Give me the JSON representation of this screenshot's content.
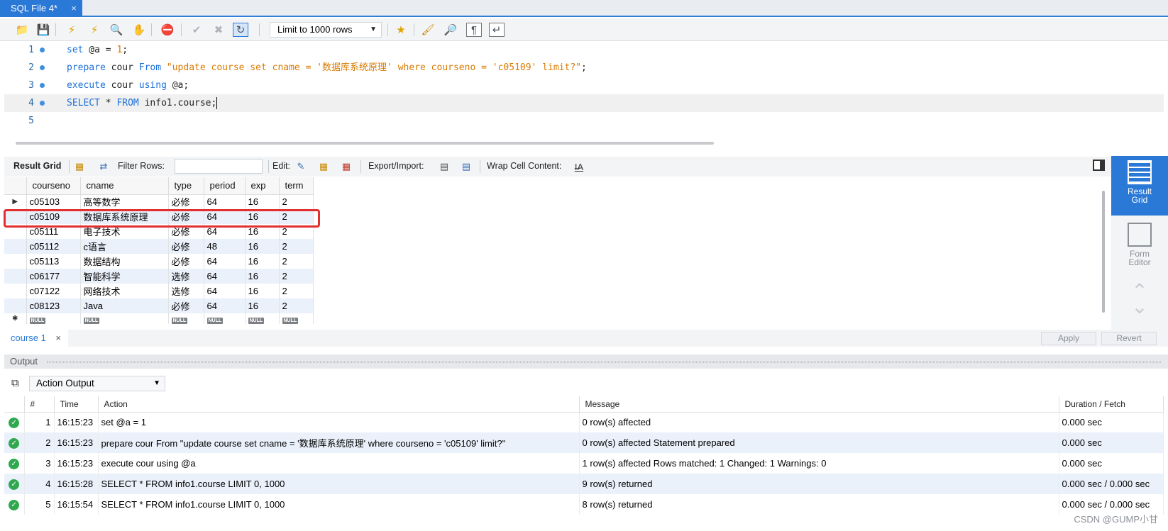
{
  "tab": {
    "title": "SQL File 4*",
    "close": "×"
  },
  "toolbar": {
    "icons": [
      "open-folder-icon",
      "save-icon",
      "execute-icon",
      "execute-current-icon",
      "explain-icon",
      "stop-icon",
      "toggle-error-icon",
      "commit-icon",
      "rollback-icon",
      "autocommit-icon",
      "bookmark-icon",
      "beautify-icon",
      "find-icon",
      "invisible-chars-icon",
      "wrap-icon"
    ],
    "limit_label": "Limit to 1000 rows"
  },
  "editor": {
    "lines": [
      {
        "num": "1",
        "dot": true
      },
      {
        "num": "2",
        "dot": true
      },
      {
        "num": "3",
        "dot": true
      },
      {
        "num": "4",
        "dot": true
      },
      {
        "num": "5",
        "dot": false
      }
    ],
    "line1": {
      "kw1": "set",
      "rest": " @a = ",
      "num": "1",
      "end": ";"
    },
    "line2": {
      "kw1": "prepare",
      "mid": " cour ",
      "kw2": "From",
      "str": "\"update course set cname = '数据库系统原理' where courseno = 'c05109' limit?\"",
      "end": ";"
    },
    "line3": {
      "kw1": "execute",
      "mid": " cour ",
      "kw2": "using",
      "end": " @a;"
    },
    "line4": {
      "kw1": "SELECT",
      "mid": " * ",
      "kw2": "FROM",
      "end": " info1.course;"
    }
  },
  "result_toolbar": {
    "result_grid": "Result Grid",
    "filter_rows": "Filter Rows:",
    "edit": "Edit:",
    "export_import": "Export/Import:",
    "wrap_cell": "Wrap Cell Content:"
  },
  "grid": {
    "columns": [
      "courseno",
      "cname",
      "type",
      "period",
      "exp",
      "term"
    ],
    "rows": [
      [
        "c05103",
        "高等数学",
        "必修",
        "64",
        "16",
        "2"
      ],
      [
        "c05109",
        "数据库系统原理",
        "必修",
        "64",
        "16",
        "2"
      ],
      [
        "c05111",
        "电子技术",
        "必修",
        "64",
        "16",
        "2"
      ],
      [
        "c05112",
        "c语言",
        "必修",
        "48",
        "16",
        "2"
      ],
      [
        "c05113",
        "数据结构",
        "必修",
        "64",
        "16",
        "2"
      ],
      [
        "c06177",
        "智能科学",
        "选修",
        "64",
        "16",
        "2"
      ],
      [
        "c07122",
        "网络技术",
        "选修",
        "64",
        "16",
        "2"
      ],
      [
        "c08123",
        "Java",
        "必修",
        "64",
        "16",
        "2"
      ]
    ],
    "null_label": "NULL",
    "current_row_marker": "▶",
    "new_row_marker": "✱"
  },
  "side_panel": {
    "result_grid": "Result Grid",
    "form_editor": "Form Editor"
  },
  "result_tabs": {
    "tab": "course 1",
    "close": "×",
    "apply": "Apply",
    "revert": "Revert"
  },
  "output": {
    "title": "Output",
    "selector": "Action Output",
    "columns": {
      "hash": "#",
      "time": "Time",
      "action": "Action",
      "message": "Message",
      "duration": "Duration / Fetch"
    },
    "rows": [
      {
        "n": "1",
        "time": "16:15:23",
        "action": "set @a = 1",
        "message": "0 row(s) affected",
        "duration": "0.000 sec"
      },
      {
        "n": "2",
        "time": "16:15:23",
        "action": "prepare cour From \"update course set cname = '数据库系统原理' where courseno = 'c05109' limit?\"",
        "message": "0 row(s) affected Statement prepared",
        "duration": "0.000 sec"
      },
      {
        "n": "3",
        "time": "16:15:23",
        "action": "execute cour using @a",
        "message": "1 row(s) affected Rows matched: 1  Changed: 1  Warnings: 0",
        "duration": "0.000 sec"
      },
      {
        "n": "4",
        "time": "16:15:28",
        "action": "SELECT * FROM info1.course LIMIT 0, 1000",
        "message": "9 row(s) returned",
        "duration": "0.000 sec / 0.000 sec"
      },
      {
        "n": "5",
        "time": "16:15:54",
        "action": "SELECT * FROM info1.course LIMIT 0, 1000",
        "message": "8 row(s) returned",
        "duration": "0.000 sec / 0.000 sec"
      }
    ]
  },
  "watermark": "CSDN @GUMP小甘",
  "colors": {
    "accent": "#2b79d6",
    "keyword": "#1a6fd8",
    "string": "#d97a00",
    "highlight": "#e23030",
    "success": "#2fa84f"
  }
}
